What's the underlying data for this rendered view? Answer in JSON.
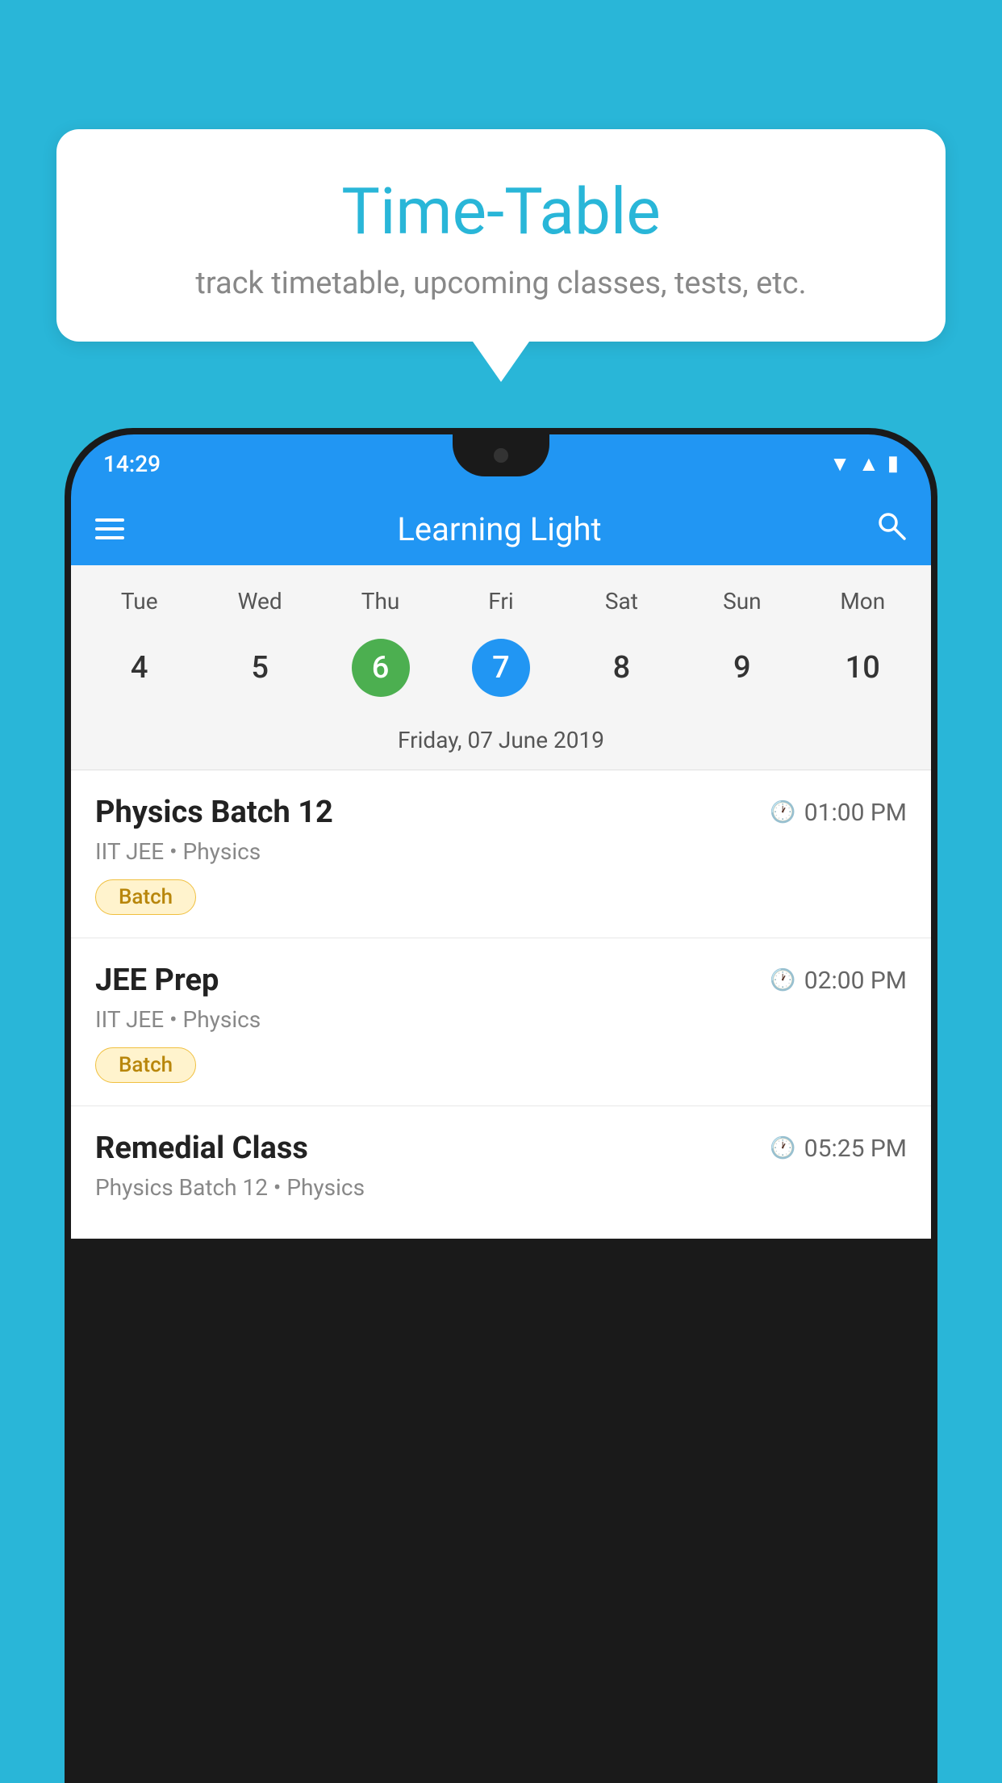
{
  "background_color": "#29b6d8",
  "speech_bubble": {
    "title": "Time-Table",
    "subtitle": "track timetable, upcoming classes, tests, etc."
  },
  "phone": {
    "status_bar": {
      "time": "14:29",
      "icons": [
        "wifi",
        "signal",
        "battery"
      ]
    },
    "app_bar": {
      "title": "Learning Light"
    },
    "calendar": {
      "days": [
        "Tue",
        "Wed",
        "Thu",
        "Fri",
        "Sat",
        "Sun",
        "Mon"
      ],
      "dates": [
        4,
        5,
        6,
        7,
        8,
        9,
        10
      ],
      "today_index": 2,
      "selected_index": 3,
      "selected_label": "Friday, 07 June 2019"
    },
    "schedule_items": [
      {
        "title": "Physics Batch 12",
        "time": "01:00 PM",
        "subtitle": "IIT JEE • Physics",
        "badge": "Batch"
      },
      {
        "title": "JEE Prep",
        "time": "02:00 PM",
        "subtitle": "IIT JEE • Physics",
        "badge": "Batch"
      },
      {
        "title": "Remedial Class",
        "time": "05:25 PM",
        "subtitle": "Physics Batch 12 • Physics",
        "badge": null
      }
    ]
  }
}
